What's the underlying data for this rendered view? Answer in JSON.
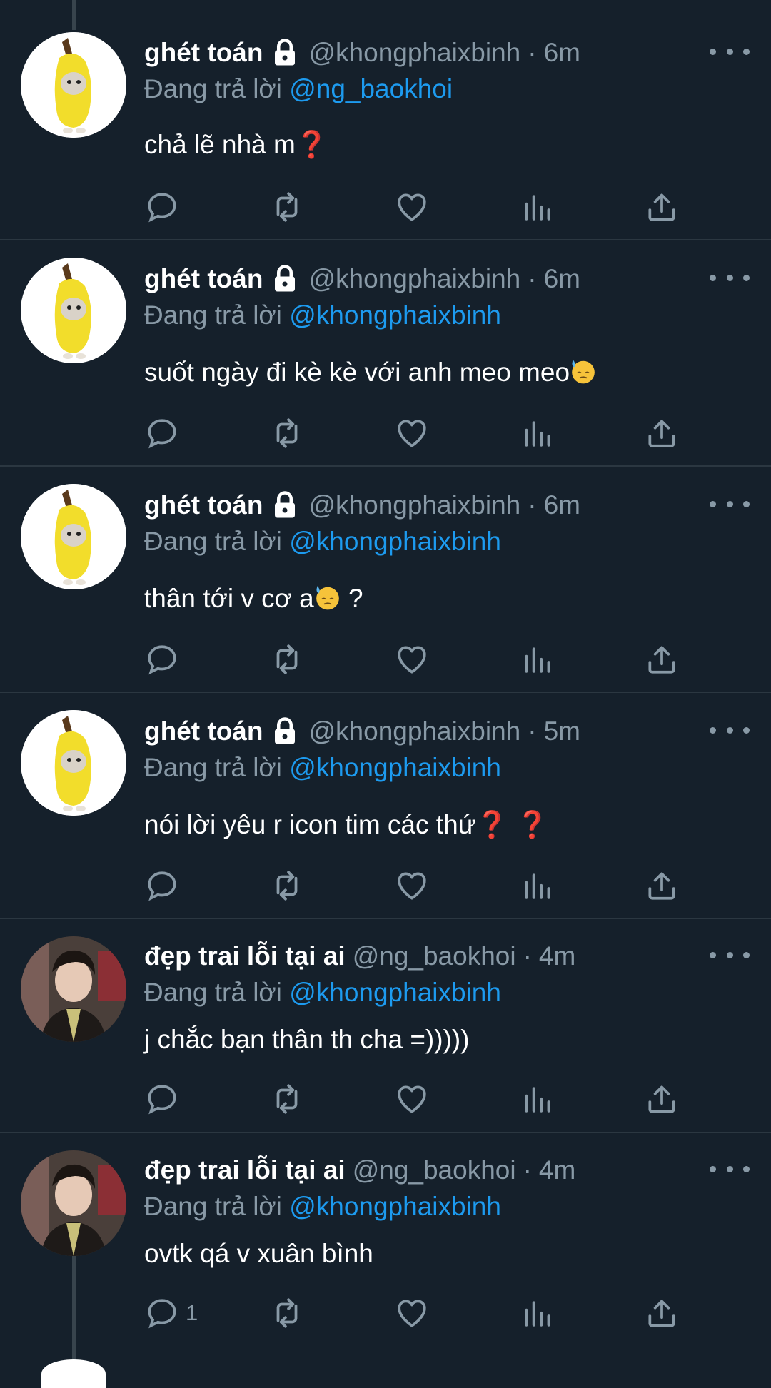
{
  "colors": {
    "background": "#15202b",
    "mention": "#1d9bf0",
    "muted": "#8899a6",
    "question": "#e0245e"
  },
  "reply_prefix": "Đang trả lời",
  "tweets": [
    {
      "name": "ghét toán",
      "locked": true,
      "handle": "@khongphaixbinh",
      "sep": "·",
      "time": "6m",
      "reply_to": "@ng_baokhoi",
      "text": "chả lẽ nhà m",
      "suffix": "❓",
      "avatar": "banana-cat",
      "reply_count": ""
    },
    {
      "name": "ghét toán",
      "locked": true,
      "handle": "@khongphaixbinh",
      "sep": "·",
      "time": "6m",
      "reply_to": "@khongphaixbinh",
      "text": "suốt ngày đi kè kè với anh meo meo",
      "suffix": "",
      "avatar": "banana-cat",
      "reply_count": ""
    },
    {
      "name": "ghét toán",
      "locked": true,
      "handle": "@khongphaixbinh",
      "sep": "·",
      "time": "6m",
      "reply_to": "@khongphaixbinh",
      "text": "thân tới v cơ a",
      "suffix": " ?",
      "avatar": "banana-cat",
      "reply_count": ""
    },
    {
      "name": "ghét toán",
      "locked": true,
      "handle": "@khongphaixbinh",
      "sep": "·",
      "time": "5m",
      "reply_to": "@khongphaixbinh",
      "text": "nói lời yêu r icon tim các thứ",
      "suffix": "❓ ❓",
      "avatar": "banana-cat",
      "reply_count": ""
    },
    {
      "name": "đẹp trai lỗi tại ai",
      "locked": false,
      "handle": "@ng_baokhoi",
      "sep": "·",
      "time": "4m",
      "reply_to": "@khongphaixbinh",
      "text": "j chắc bạn thân th cha =)))))",
      "suffix": "",
      "avatar": "person-photo",
      "reply_count": ""
    },
    {
      "name": "đẹp trai lỗi tại ai",
      "locked": false,
      "handle": "@ng_baokhoi",
      "sep": "·",
      "time": "4m",
      "reply_to": "@khongphaixbinh",
      "text": "ovtk qá v xuân bình",
      "suffix": "",
      "avatar": "person-photo",
      "reply_count": "1"
    }
  ]
}
